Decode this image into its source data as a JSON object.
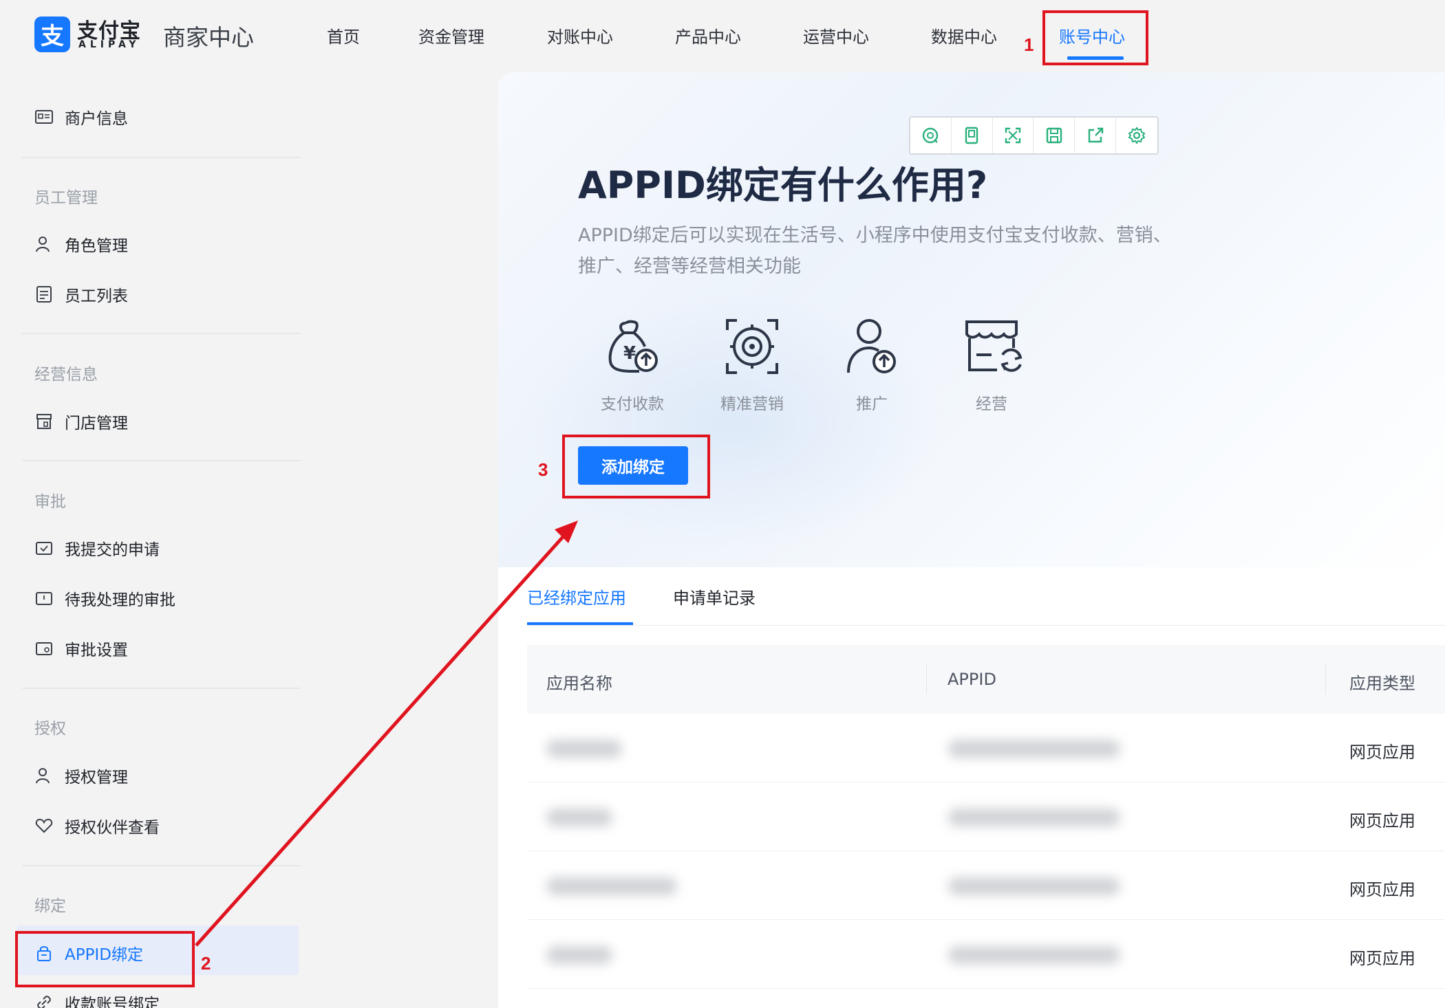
{
  "brand": {
    "logo_cn": "支付宝",
    "logo_en": "ALIPAY",
    "title": "商家中心"
  },
  "nav": {
    "items": [
      "首页",
      "资金管理",
      "对账中心",
      "产品中心",
      "运营中心",
      "数据中心",
      "账号中心"
    ],
    "active_index": 6
  },
  "sidebar": {
    "merchant_info": "商户信息",
    "groups": [
      {
        "title": "员工管理",
        "items": [
          "角色管理",
          "员工列表"
        ]
      },
      {
        "title": "经营信息",
        "items": [
          "门店管理"
        ]
      },
      {
        "title": "审批",
        "items": [
          "我提交的申请",
          "待我处理的审批",
          "审批设置"
        ]
      },
      {
        "title": "授权",
        "items": [
          "授权管理",
          "授权伙伴查看"
        ]
      },
      {
        "title": "绑定",
        "items": [
          "APPID绑定",
          "收款账号绑定"
        ]
      }
    ],
    "active_item": "APPID绑定"
  },
  "main": {
    "title": "APPID绑定有什么作用?",
    "description": "APPID绑定后可以实现在生活号、小程序中使用支付宝支付收款、营销、推广、经营等经营相关功能",
    "features": [
      {
        "icon": "money-bag-icon",
        "label": "支付收款"
      },
      {
        "icon": "target-icon",
        "label": "精准营销"
      },
      {
        "icon": "user-upload-icon",
        "label": "推广"
      },
      {
        "icon": "store-icon",
        "label": "经营"
      }
    ],
    "add_button": "添加绑定",
    "tabs": [
      "已经绑定应用",
      "申请单记录"
    ],
    "active_tab": 0,
    "table": {
      "columns": [
        "应用名称",
        "APPID",
        "应用类型"
      ],
      "rows": [
        {
          "name": "",
          "appid": "",
          "type": "网页应用"
        },
        {
          "name": "",
          "appid": "",
          "type": "网页应用"
        },
        {
          "name": "",
          "appid": "",
          "type": "网页应用"
        },
        {
          "name": "",
          "appid": "",
          "type": "网页应用"
        }
      ]
    }
  },
  "toolbar_icons": [
    "refresh-icon",
    "bookmark-icon",
    "fullscreen-icon",
    "save-icon",
    "share-icon",
    "settings-icon"
  ],
  "annotations": {
    "step1": "1",
    "step2": "2",
    "step3": "3",
    "color": "#e0141e"
  },
  "colors": {
    "accent": "#1677ff",
    "toolbar_icon": "#27b07a"
  }
}
